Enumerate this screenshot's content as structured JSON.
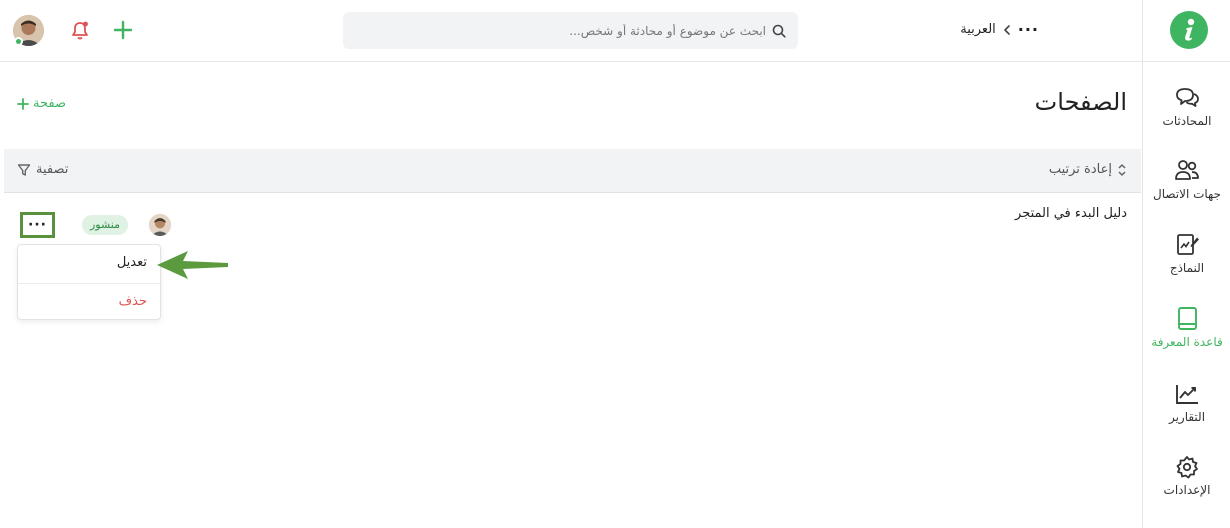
{
  "colors": {
    "accent": "#3fb561",
    "danger": "#e05252",
    "highlight_border": "#5a913c",
    "annotation_arrow": "#5c9a3f",
    "badge_bg": "#dff2e3"
  },
  "sidebar": {
    "logo_icon": "info-logo-icon",
    "items": [
      {
        "label": "المحادثات",
        "icon": "chat-bubbles-icon",
        "active": false
      },
      {
        "label": "جهات الاتصال",
        "icon": "contacts-icon",
        "active": false
      },
      {
        "label": "النماذج",
        "icon": "forms-icon",
        "active": false
      },
      {
        "label": "قاعدة المعرفة",
        "icon": "book-icon",
        "active": true
      },
      {
        "label": "التقارير",
        "icon": "reports-chart-icon",
        "active": false
      },
      {
        "label": "الإعدادات",
        "icon": "settings-gear-icon",
        "active": false
      }
    ]
  },
  "topbar": {
    "breadcrumb_current": "العربية",
    "search_placeholder": "ابحث عن موضوع أو محادثة أو شخص..."
  },
  "main": {
    "title": "الصفحات",
    "add_page_label": "صفحة",
    "sort_label": "إعادة ترتيب",
    "filter_label": "تصفية",
    "rows": [
      {
        "title": "دليل البدء في المتجر",
        "status": "منشور"
      }
    ],
    "menu": {
      "edit_label": "تعديل",
      "delete_label": "حذف"
    }
  }
}
